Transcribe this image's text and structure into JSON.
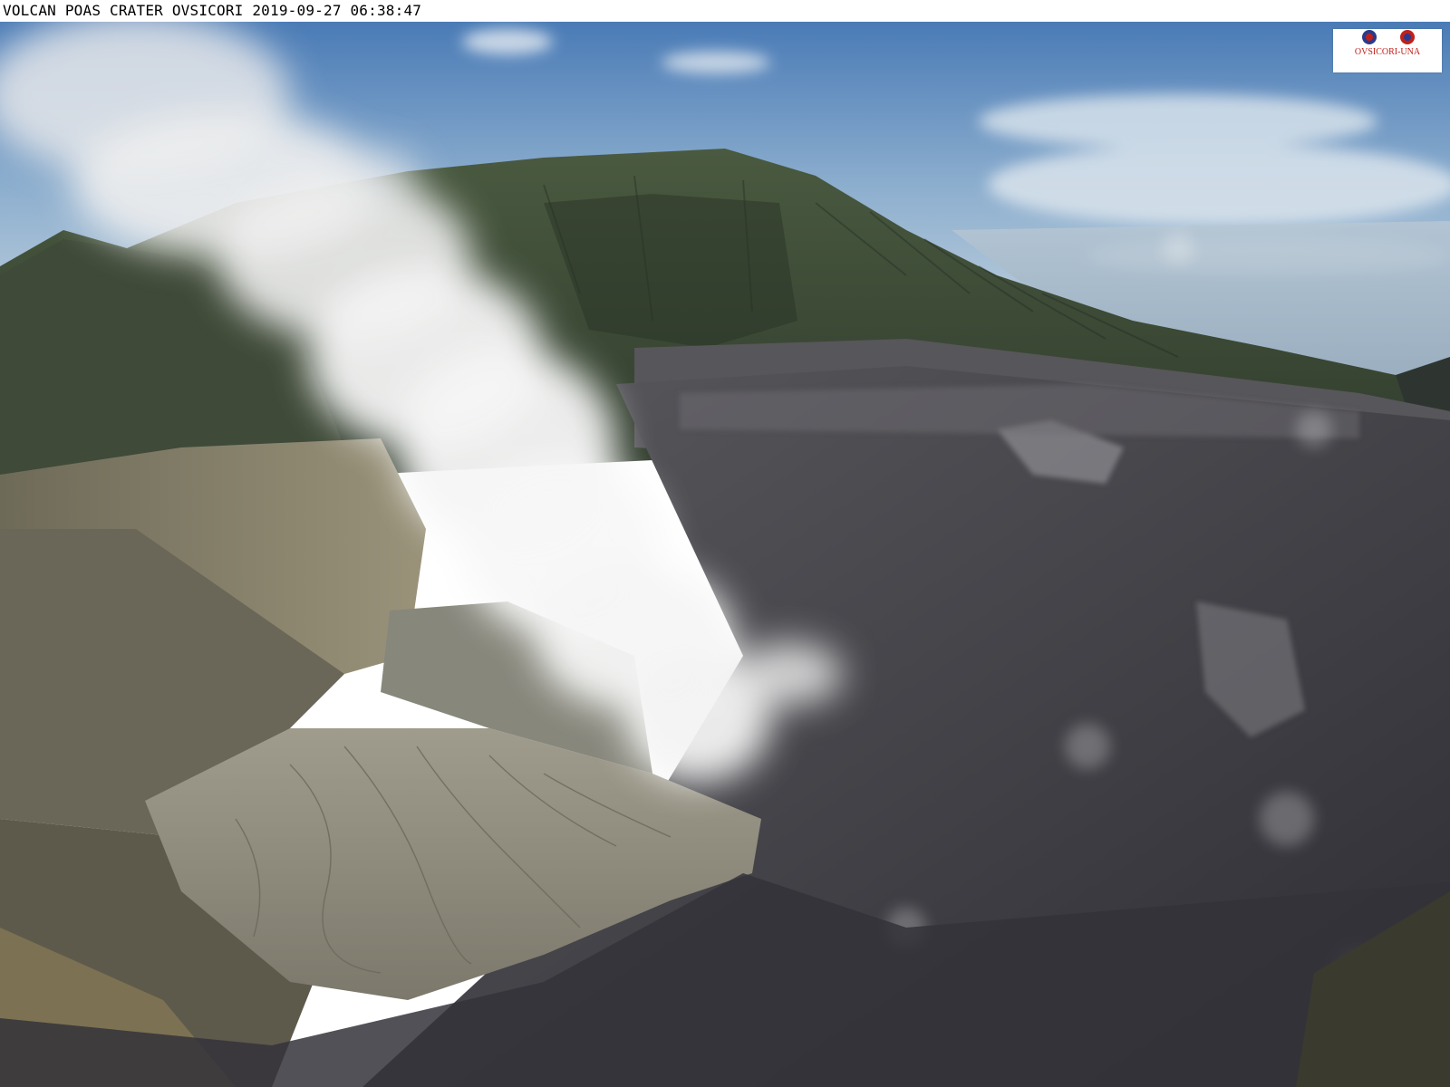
{
  "overlay": {
    "caption": "VOLCAN POAS CRATER OVSICORI 2019-09-27 06:38:47"
  },
  "logo": {
    "name": "OVSICORI-UNA"
  },
  "colors": {
    "sky_top": "#4f7fb8",
    "sky_bottom": "#c9d6df",
    "ridge": "#3d4a36",
    "crater_floor": "#8a8679",
    "crater_dark": "#3e3d44",
    "plume": "#f2f2f2",
    "logo_red": "#c0201a",
    "logo_blue": "#2a3a8a"
  }
}
